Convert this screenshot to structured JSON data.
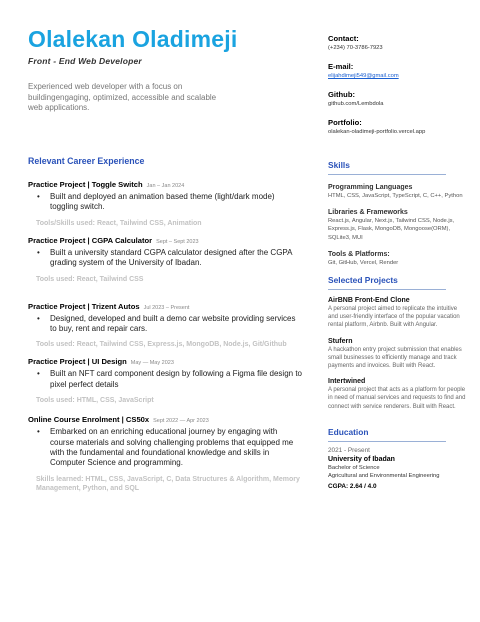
{
  "header": {
    "name": "Olalekan Oladimeji",
    "role": "Front - End Web Developer",
    "summary": "Experienced web developer with a focus on buildingengaging, optimized, accessible and scalable web applications."
  },
  "experience": {
    "title": "Relevant Career Experience",
    "items": [
      {
        "title": "Practice Project | Toggle Switch",
        "date": "Jan – Jan 2024",
        "bullets": [
          "Built and deployed an animation based theme (light/dark mode) toggling switch."
        ],
        "tools": "Tools/Skills used:  React, Tailwind CSS, Animation"
      },
      {
        "title": "Practice Project | CGPA Calculator",
        "date": "Sept – Sept 2023",
        "bullets": [
          "Built a university standard CGPA calculator designed after the CGPA grading system of the University of Ibadan."
        ],
        "tools": "Tools used: React, Tailwind CSS"
      },
      {
        "title": "Practice Project | Trizent Autos",
        "date": "Jul 2023 – Present",
        "bullets": [
          "Designed, developed and built a demo car website providing services to buy, rent and repair cars."
        ],
        "tools": "Tools used: React, Tailwind CSS, Express.js, MongoDB, Node.js, Git/Github"
      },
      {
        "title": "Practice Project | UI Design",
        "date": "May — May 2023",
        "bullets": [
          "Built an NFT card component design by following a Figma file design to pixel perfect details"
        ],
        "tools": "Tools used: HTML, CSS, JavaScript"
      },
      {
        "title": "Online Course Enrolment | CS50x",
        "date": "Sept 2022 — Apr 2023",
        "bullets": [
          "Embarked on an enriching educational journey by engaging with course materials and solving challenging problems that equipped me with the fundamental and foundational knowledge and skills in Computer Science and programming."
        ],
        "tools": "Skills learned: HTML, CSS, JavaScript, C, Data Structures & Algorithm, Memory Management, Python, and SQL"
      }
    ]
  },
  "contact": {
    "contact_label": "Contact:",
    "phone": "(+234) 70-3786-7923",
    "email_label": "E-mail:",
    "email": "elijahdimeji549@gmail.com",
    "github_label": "Github:",
    "github": "github.com/Lembdola",
    "portfolio_label": "Portfolio:",
    "portfolio": "olalekan-oladimeji-portfolio.vercel.app"
  },
  "skills": {
    "title": "Skills",
    "groups": [
      {
        "label": "Programming Languages",
        "value": "HTML, CSS, JavaScript, TypeScript, C, C++, Python"
      },
      {
        "label": "Libraries & Frameworks",
        "value": "React.js, Angular, Next.js, Tailwind CSS, Node.js, Express.js, Flask, MongoDB, Mongoose(ORM), SQLite3, MUI"
      },
      {
        "label": "Tools & Platforms:",
        "value": "Git, GitHub, Vercel, Render"
      }
    ]
  },
  "projects": {
    "title": "Selected Projects",
    "items": [
      {
        "title": "AirBNB Front-End Clone",
        "desc": "A personal project aimed to replicate the intuitive and user-friendly interface of the popular vacation rental platform, Airbnb. Built with Angular."
      },
      {
        "title": "Stufern",
        "desc": "A hackathon entry project submission that enables small businesses to efficiently manage and track payments and invoices. Built with React."
      },
      {
        "title": "Intertwined",
        "desc": "A personal project that acts as a platform for people in need of manual services and requests to find and connect with service renderers. Built with React."
      }
    ]
  },
  "education": {
    "title": "Education",
    "years": "2021 - Present",
    "school": "University of Ibadan",
    "degree": "Bachelor of Science",
    "field": "Agricultural and Environmental Engineering",
    "gpa": "CGPA: 2.64 / 4.0"
  },
  "colors": {
    "name": "#1aa3e0",
    "section": "#2a52b9",
    "muted": "#c2c2c2"
  }
}
